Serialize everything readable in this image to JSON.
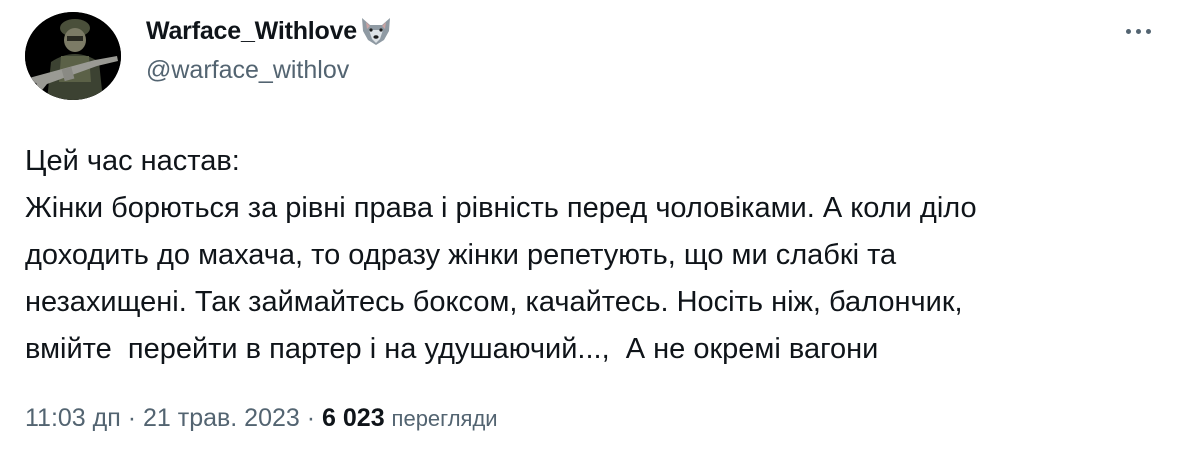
{
  "tweet": {
    "author": {
      "display_name": "Warface_Withlove",
      "name_emoji": "wolf-face-icon",
      "handle": "@warface_withlov",
      "avatar": "soldier-with-rifle-avatar"
    },
    "more_icon": "ellipsis-icon",
    "text_lines": [
      "Цей час настав:",
      "Жінки борються за рівні права і рівність перед чоловіками. А коли діло",
      "доходить до махача, то одразу жінки репетують, що ми слабкі та",
      "незахищені. Так займайтесь боксом, качайтесь. Носіть ніж, балончик,",
      "вмійте  перейти в партер і на удушаючий...,  А не окремі вагони"
    ],
    "time": "11:03 дп",
    "separator": " · ",
    "date": "21 трав. 2023",
    "views_count": "6 023",
    "views_label": "перегляди"
  },
  "colors": {
    "text_primary": "#0f1419",
    "text_secondary": "#536471",
    "background": "#ffffff"
  }
}
